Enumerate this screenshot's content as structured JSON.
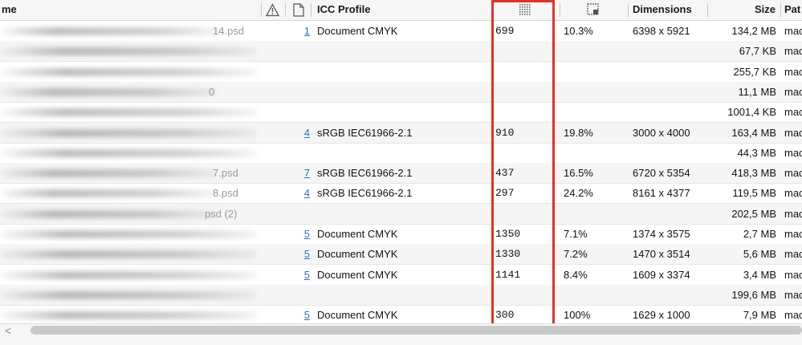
{
  "columns": {
    "name": "me",
    "warning_icon": "warning-triangle-icon",
    "document_icon": "document-icon",
    "icc_profile": "ICC Profile",
    "resolution_icon": "dotted-grid-icon",
    "compression_icon": "crop-square-icon",
    "dimensions": "Dimensions",
    "size": "Size",
    "path": "Pat"
  },
  "rows": [
    {
      "name_suffix": "14.psd",
      "layers": "1",
      "icc": "Document CMYK",
      "res": "699",
      "pct": "10.3%",
      "dims": "6398 x 5921",
      "size": "134,2 MB",
      "path": "mac"
    },
    {
      "name_suffix": "",
      "layers": "",
      "icc": "",
      "res": "",
      "pct": "",
      "dims": "",
      "size": "67,7 KB",
      "path": "mac"
    },
    {
      "name_suffix": "",
      "layers": "",
      "icc": "",
      "res": "",
      "pct": "",
      "dims": "",
      "size": "255,7 KB",
      "path": "mac"
    },
    {
      "name_suffix": "0",
      "layers": "",
      "icc": "",
      "res": "",
      "pct": "",
      "dims": "",
      "size": "11,1 MB",
      "path": "mac"
    },
    {
      "name_suffix": "",
      "layers": "",
      "icc": "",
      "res": "",
      "pct": "",
      "dims": "",
      "size": "1001,4 KB",
      "path": "mac"
    },
    {
      "name_suffix": "",
      "layers": "4",
      "icc": "sRGB IEC61966-2.1",
      "res": "910",
      "pct": "19.8%",
      "dims": "3000 x 4000",
      "size": "163,4 MB",
      "path": "mac"
    },
    {
      "name_suffix": "",
      "layers": "",
      "icc": "",
      "res": "",
      "pct": "",
      "dims": "",
      "size": "44,3 MB",
      "path": "mac"
    },
    {
      "name_suffix": "7.psd",
      "layers": "7",
      "icc": "sRGB IEC61966-2.1",
      "res": "437",
      "pct": "16.5%",
      "dims": "6720 x 5354",
      "size": "418,3 MB",
      "path": "mac"
    },
    {
      "name_suffix": "8.psd",
      "layers": "4",
      "icc": "sRGB IEC61966-2.1",
      "res": "297",
      "pct": "24.2%",
      "dims": "8161 x 4377",
      "size": "119,5 MB",
      "path": "mac"
    },
    {
      "name_suffix": "psd (2)",
      "layers": "",
      "icc": "",
      "res": "",
      "pct": "",
      "dims": "",
      "size": "202,5 MB",
      "path": "mac"
    },
    {
      "name_suffix": "",
      "layers": "5",
      "icc": "Document CMYK",
      "res": "1350",
      "pct": "7.1%",
      "dims": "1374 x 3575",
      "size": "2,7 MB",
      "path": "mac"
    },
    {
      "name_suffix": "",
      "layers": "5",
      "icc": "Document CMYK",
      "res": "1330",
      "pct": "7.2%",
      "dims": "1470 x 3514",
      "size": "5,6 MB",
      "path": "mac"
    },
    {
      "name_suffix": "",
      "layers": "5",
      "icc": "Document CMYK",
      "res": "1141",
      "pct": "8.4%",
      "dims": "1609 x 3374",
      "size": "3,4 MB",
      "path": "mac"
    },
    {
      "name_suffix": "",
      "layers": "",
      "icc": "",
      "res": "",
      "pct": "",
      "dims": "",
      "size": "199,6 MB",
      "path": "mac"
    },
    {
      "name_suffix": "",
      "layers": "5",
      "icc": "Document CMYK",
      "res": "300",
      "pct": "100%",
      "dims": "1629 x 1000",
      "size": "7,9 MB",
      "path": "mac"
    }
  ],
  "scrollbar": {
    "left_arrow": "<"
  },
  "colors": {
    "highlight": "#e43222",
    "link": "#2a6fd6"
  }
}
